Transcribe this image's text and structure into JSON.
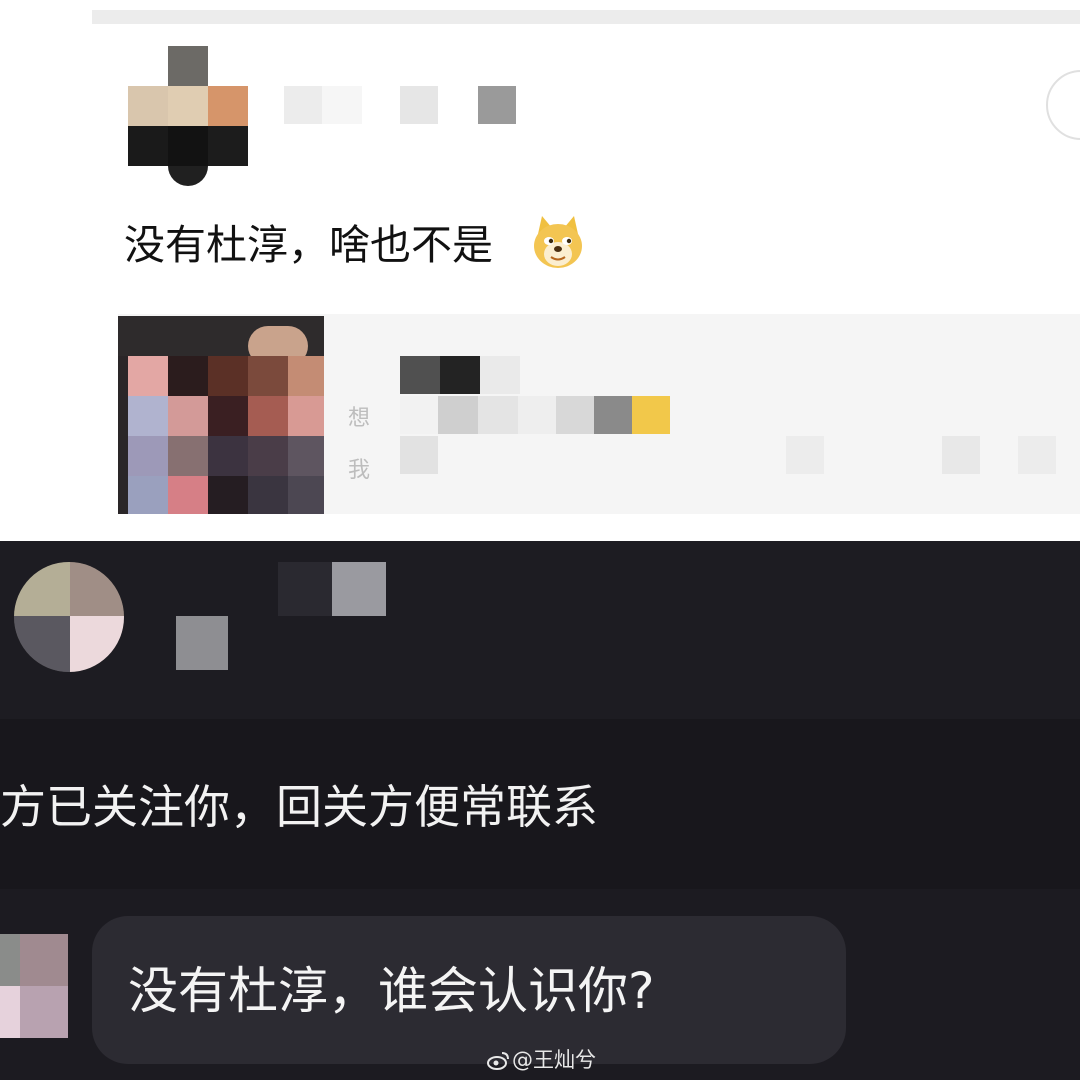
{
  "top_post": {
    "author_name": "",
    "text": "没有杜淳，啥也不是",
    "emoji": "doge-emoji",
    "quoted_post": {
      "line1_prefix": "想",
      "line2_prefix": "我"
    }
  },
  "chat": {
    "system_notice": "方已关注你，回关方便常联系",
    "message": "没有杜淳，谁会认识你?"
  },
  "watermark": {
    "text": "@王灿兮"
  },
  "colors": {
    "light_bg": "#ffffff",
    "dark_bg": "#1c1b21",
    "bubble_bg": "#2c2b32"
  }
}
